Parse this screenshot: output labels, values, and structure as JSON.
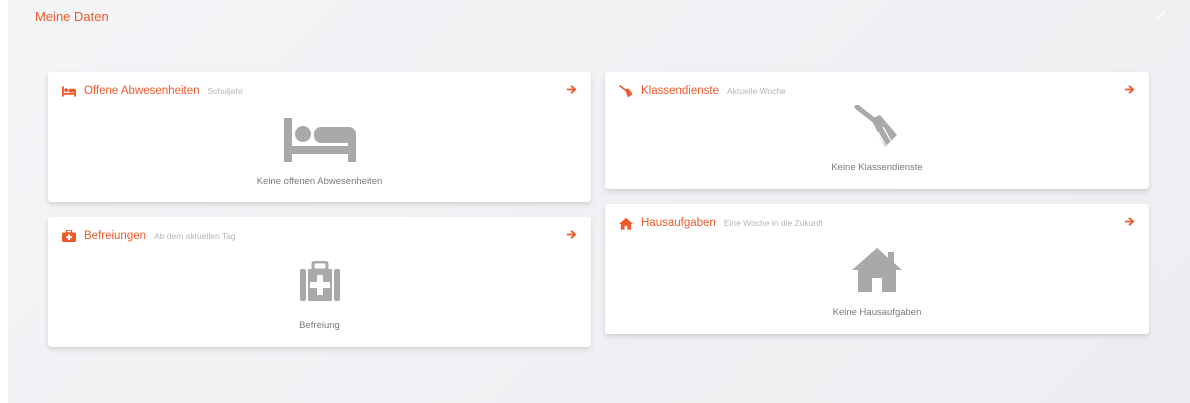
{
  "page": {
    "title": "Meine Daten"
  },
  "colors": {
    "accent": "#ef5a2c",
    "icon_gray": "#a9a9a9",
    "muted_text": "#b5b5b5"
  },
  "cards": {
    "absences": {
      "title": "Offene Abwesenheiten",
      "subtitle": "Schuljahr",
      "empty": "Keine offenen Abwesenheiten",
      "icon": "bed-icon"
    },
    "exemptions": {
      "title": "Befreiungen",
      "subtitle": "Ab dem aktuellen Tag",
      "empty": "Befreiung",
      "icon": "first-aid-kit-icon"
    },
    "duties": {
      "title": "Klassendienste",
      "subtitle": "Aktuelle Woche",
      "empty": "Keine Klassendienste",
      "icon": "broom-icon"
    },
    "homework": {
      "title": "Hausaufgaben",
      "subtitle": "Eine Woche in die Zukunft",
      "empty": "Keine Hausaufgaben",
      "icon": "house-icon"
    }
  }
}
